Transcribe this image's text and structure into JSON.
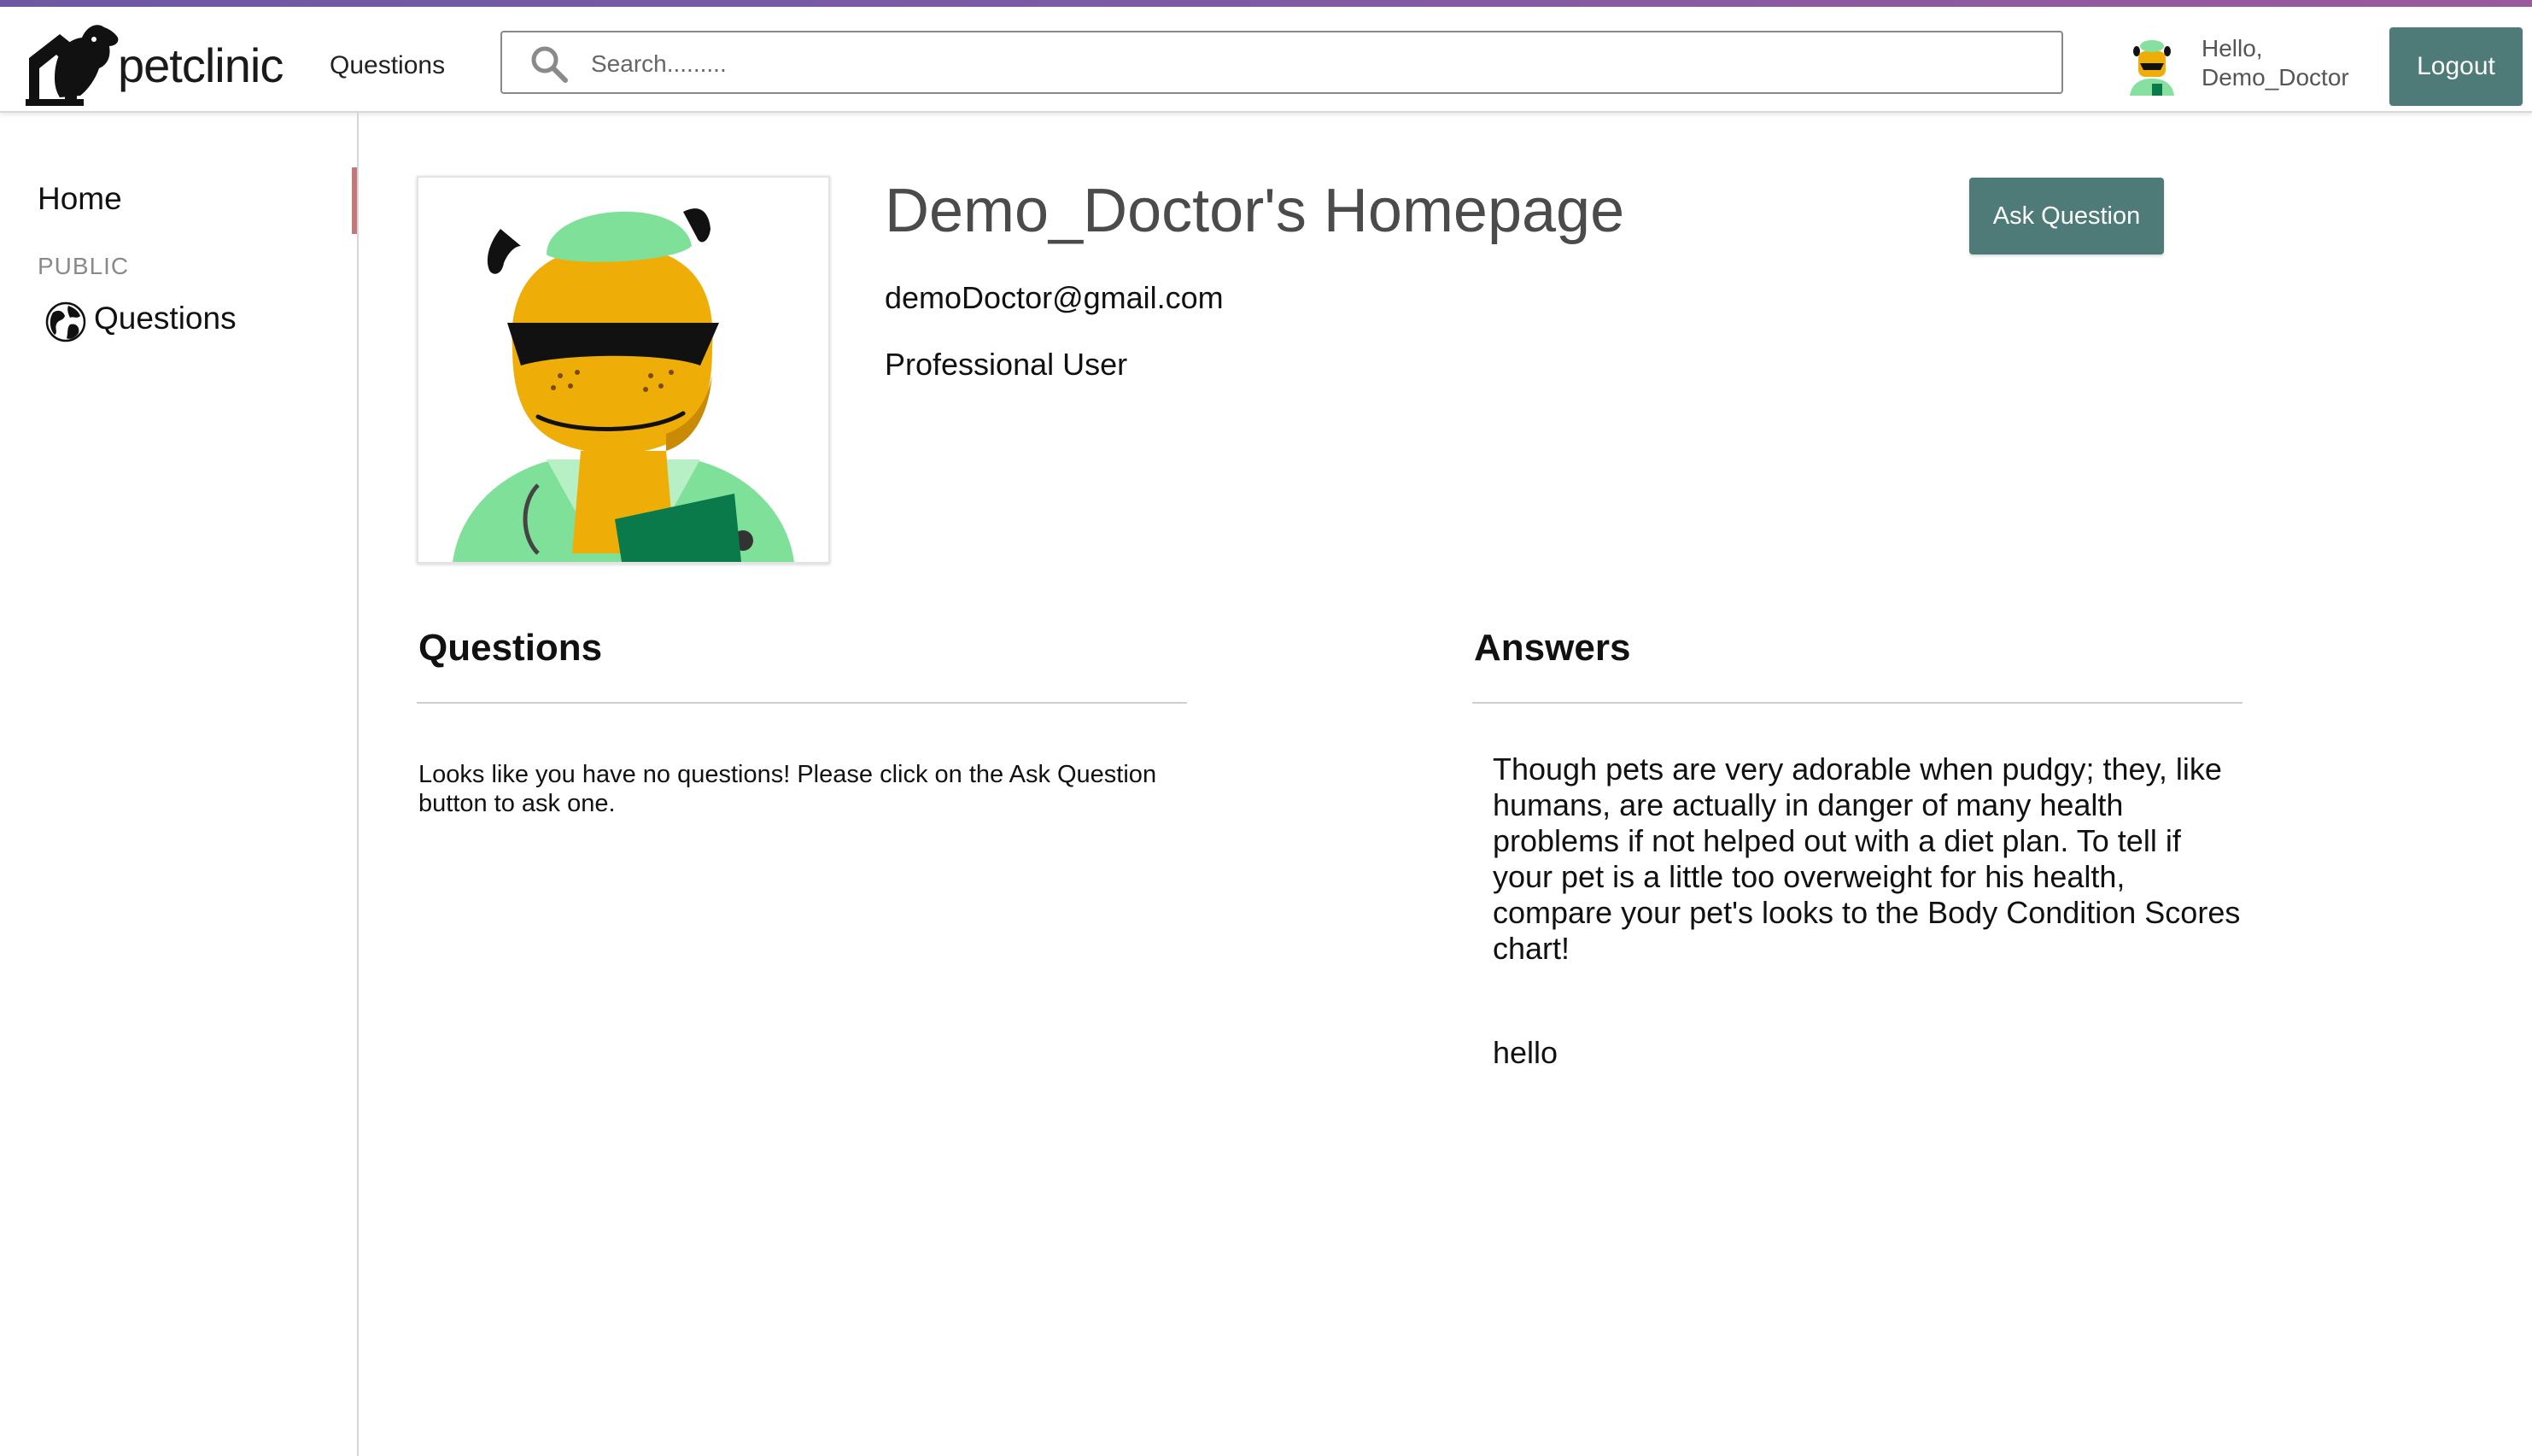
{
  "brand": {
    "name": "petclinic"
  },
  "header": {
    "nav_questions": "Questions",
    "search_placeholder": "Search.........",
    "greeting_line1": "Hello,",
    "greeting_line2": "Demo_Doctor",
    "logout_label": "Logout"
  },
  "sidebar": {
    "home_label": "Home",
    "section_label": "PUBLIC",
    "questions_label": "Questions"
  },
  "profile": {
    "title": "Demo_Doctor's Homepage",
    "email": "demoDoctor@gmail.com",
    "role": "Professional User",
    "ask_button": "Ask Question"
  },
  "questions": {
    "heading": "Questions",
    "empty_message": "Looks like you have no questions! Please click on the Ask Question button to ask one."
  },
  "answers": {
    "heading": "Answers",
    "items": [
      "Though pets are very adorable when pudgy; they, like humans, are actually in danger of many health problems if not helped out with a diet plan. To tell if your pet is a little too overweight for his health, compare your pet's looks to the Body Condition Scores chart!",
      "hello"
    ]
  },
  "colors": {
    "accent": "#4e7b77",
    "top_stripe": "#7a5aa6",
    "sidebar_active_marker": "#c07878"
  },
  "icons": {
    "logo": "dog-house-logo-icon",
    "search": "search-icon",
    "globe": "globe-icon"
  }
}
